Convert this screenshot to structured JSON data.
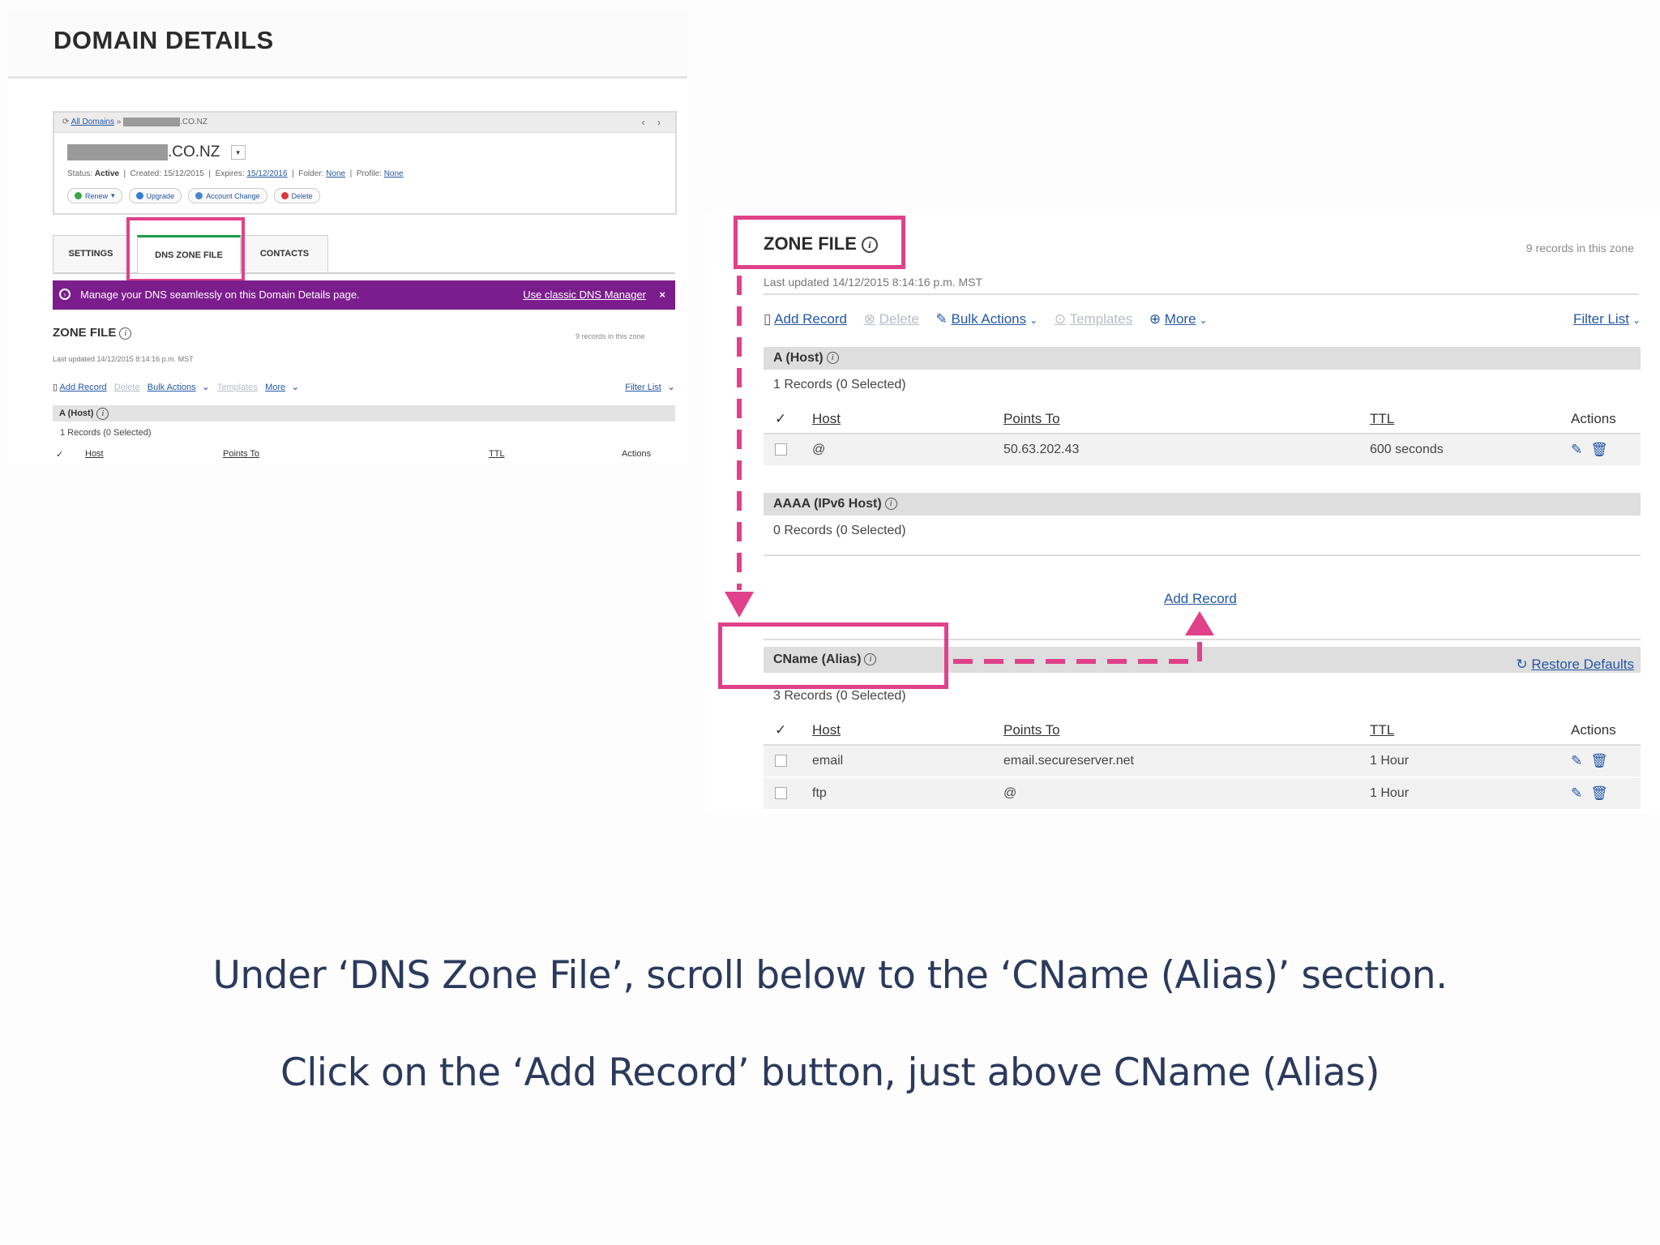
{
  "left": {
    "title": "DOMAIN DETAILS",
    "breadcrumb_link": "All Domains",
    "breadcrumb_sep": "»",
    "breadcrumb_tld": ".CO.NZ",
    "nav_arrows": "‹ ›",
    "domain_suffix": ".CO.NZ",
    "status_label": "Status:",
    "status_value": "Active",
    "created": "Created: 15/12/2015",
    "expires_label": "Expires:",
    "expires_value": "15/12/2016",
    "folder_label": "Folder:",
    "folder_value": "None",
    "profile_label": "Profile:",
    "profile_value": "None",
    "actions": [
      "Renew",
      "Upgrade",
      "Account Change",
      "Delete"
    ],
    "tabs": [
      "SETTINGS",
      "DNS ZONE FILE",
      "CONTACTS"
    ],
    "banner_text": "Manage your DNS seamlessly on this Domain Details page.",
    "banner_link": "Use classic DNS Manager",
    "banner_close": "×",
    "zone_title": "ZONE FILE",
    "zone_count": "9 records in this zone",
    "zone_updated": "Last updated 14/12/2015 8:14:16 p.m. MST",
    "toolbar": {
      "add": "Add Record",
      "delete": "Delete",
      "bulk": "Bulk Actions",
      "templates": "Templates",
      "more": "More",
      "filter": "Filter List"
    },
    "section": "A (Host)",
    "records": "1 Records (0 Selected)",
    "headers": {
      "host": "Host",
      "points": "Points To",
      "ttl": "TTL",
      "actions": "Actions"
    }
  },
  "right": {
    "zone_title": "ZONE FILE",
    "zone_count": "9 records in this zone",
    "zone_updated": "Last updated 14/12/2015 8:14:16 p.m. MST",
    "toolbar": {
      "add": "Add Record",
      "delete": "Delete",
      "bulk": "Bulk Actions",
      "templates": "Templates",
      "more": "More",
      "filter": "Filter List"
    },
    "headers": {
      "host": "Host",
      "points": "Points To",
      "ttl": "TTL",
      "actions": "Actions"
    },
    "a_section": "A (Host)",
    "a_records": "1 Records (0 Selected)",
    "a_rows": [
      {
        "host": "@",
        "points": "50.63.202.43",
        "ttl": "600 seconds"
      }
    ],
    "aaaa_section": "AAAA (IPv6 Host)",
    "aaaa_records": "0 Records (0 Selected)",
    "add_record": "Add Record",
    "cname_section": "CName (Alias)",
    "restore": "Restore Defaults",
    "cname_records": "3 Records (0 Selected)",
    "cname_rows": [
      {
        "host": "email",
        "points": "email.secureserver.net",
        "ttl": "1 Hour"
      },
      {
        "host": "ftp",
        "points": "@",
        "ttl": "1 Hour"
      }
    ]
  },
  "instructions": {
    "line1": "Under ‘DNS Zone File’, scroll below to the ‘CName (Alias)’ section.",
    "line2": "Click on the ‘Add Record’ button, just above CName (Alias)"
  },
  "colors": {
    "highlight": "#e0418a",
    "banner": "#7b1d8c",
    "link": "#2457a6",
    "active_tab": "#1a9a4b"
  }
}
